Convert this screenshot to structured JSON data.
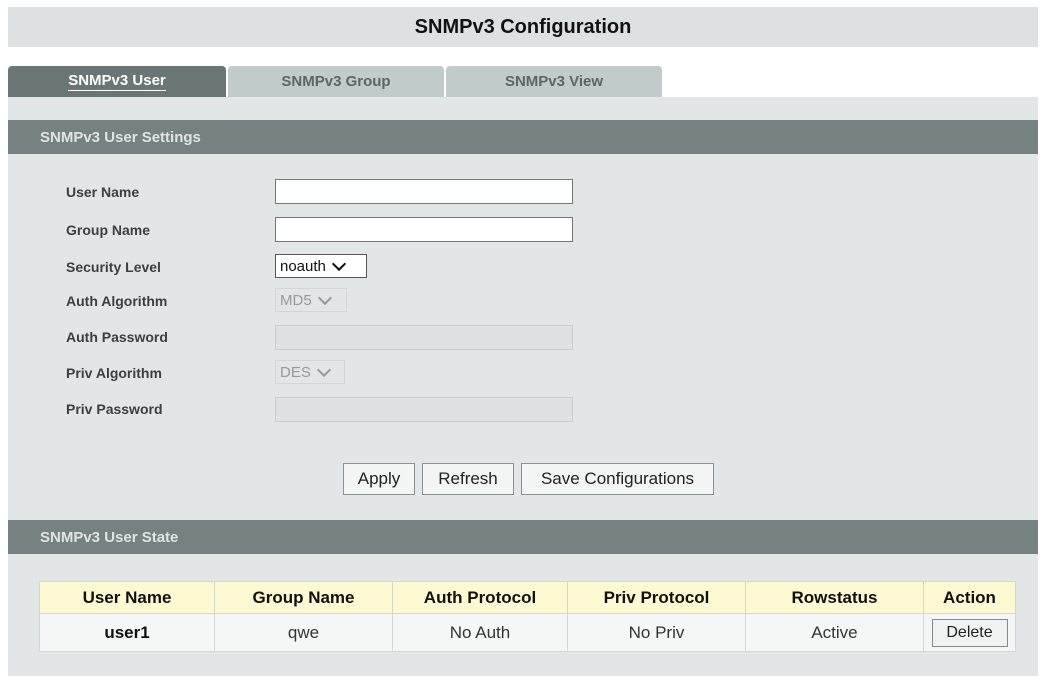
{
  "page": {
    "title": "SNMPv3 Configuration"
  },
  "tabs": [
    {
      "label": "SNMPv3 User",
      "active": true
    },
    {
      "label": "SNMPv3 Group",
      "active": false
    },
    {
      "label": "SNMPv3 View",
      "active": false
    }
  ],
  "settings": {
    "header": "SNMPv3 User Settings",
    "user_name": {
      "label": "User Name",
      "value": ""
    },
    "group_name": {
      "label": "Group Name",
      "value": ""
    },
    "security_level": {
      "label": "Security Level",
      "value": "noauth"
    },
    "auth_algorithm": {
      "label": "Auth Algorithm",
      "value": "MD5",
      "disabled": true
    },
    "auth_password": {
      "label": "Auth Password",
      "value": "",
      "disabled": true
    },
    "priv_algorithm": {
      "label": "Priv Algorithm",
      "value": "DES",
      "disabled": true
    },
    "priv_password": {
      "label": "Priv Password",
      "value": "",
      "disabled": true
    }
  },
  "buttons": {
    "apply": "Apply",
    "refresh": "Refresh",
    "save": "Save Configurations"
  },
  "state": {
    "header": "SNMPv3 User State",
    "columns": [
      "User Name",
      "Group Name",
      "Auth Protocol",
      "Priv Protocol",
      "Rowstatus",
      "Action"
    ],
    "rows": [
      {
        "user_name": "user1",
        "group_name": "qwe",
        "auth_protocol": "No Auth",
        "priv_protocol": "No Priv",
        "rowstatus": "Active",
        "action": "Delete"
      }
    ]
  },
  "colors": {
    "header_bar": "#758281",
    "active_tab": "#6a7675",
    "inactive_tab": "#c1cbca",
    "panel_bg": "#e2e6e6",
    "table_header_bg": "#fdf9d2"
  }
}
